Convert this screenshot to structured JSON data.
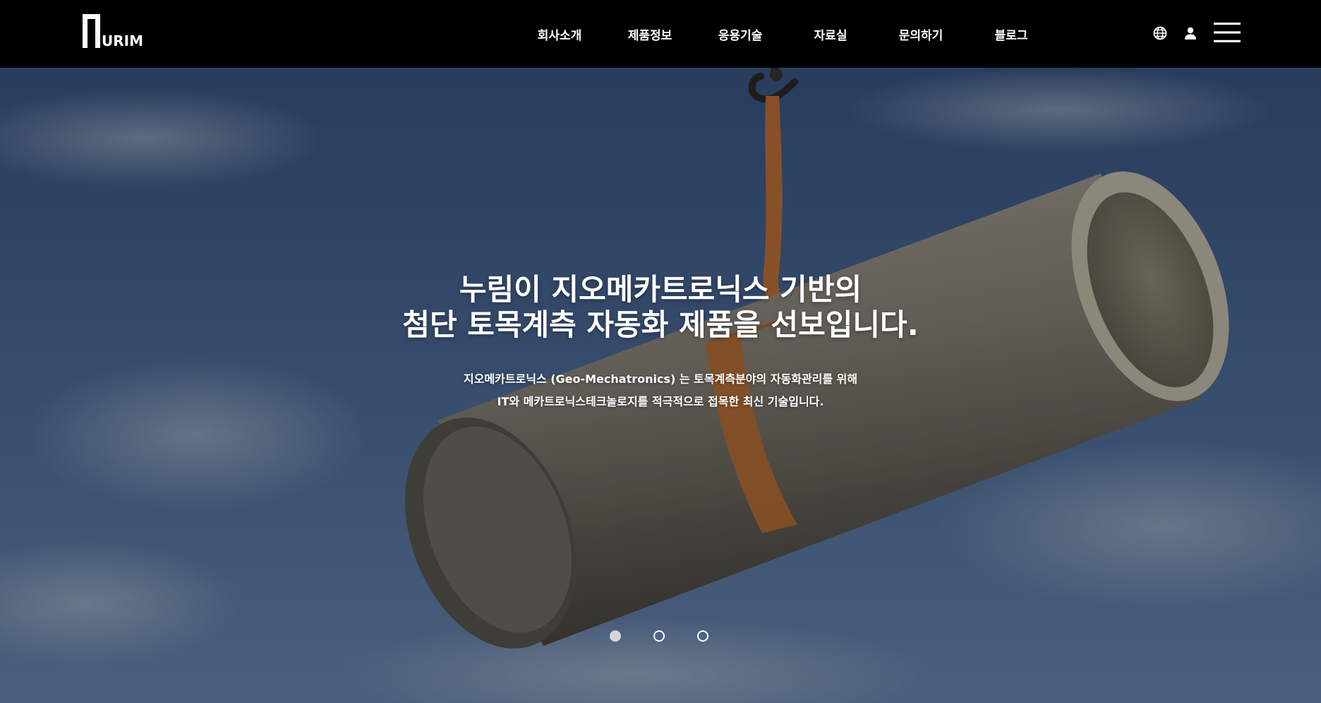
{
  "header": {
    "logo_text": "URIM",
    "nav": [
      {
        "label": "회사소개"
      },
      {
        "label": "제품정보"
      },
      {
        "label": "응용기술"
      },
      {
        "label": "자료실"
      },
      {
        "label": "문의하기"
      },
      {
        "label": "블로그"
      }
    ],
    "icons": [
      "globe-icon",
      "user-icon",
      "hamburger-menu-icon"
    ]
  },
  "hero": {
    "title_line1": "누림이 지오메카트로닉스 기반의",
    "title_line2": "첨단 토목계측 자동화 제품을 선보입니다.",
    "subtitle_line1": "지오메카트로닉스 (Geo-Mechatronics) 는 토목계측분야의 자동화관리를 위해",
    "subtitle_line2": "IT와 메카트로닉스테크놀로지를 적극적으로 접목한 최신 기술입니다.",
    "slides": {
      "count": 3,
      "active": 1
    }
  },
  "colors": {
    "header_bg": "#000000",
    "text": "#ffffff",
    "sky": "#4b6a9a",
    "strap": "#c9773a",
    "pipe": "#8e8b82"
  }
}
